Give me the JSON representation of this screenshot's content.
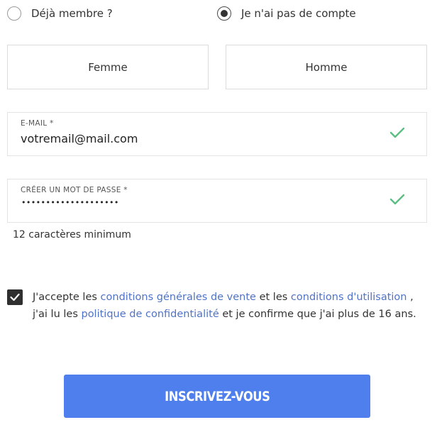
{
  "account_choice": {
    "options": [
      {
        "label": "Déjà membre ?",
        "selected": false
      },
      {
        "label": "Je n'ai pas de compte",
        "selected": true
      }
    ]
  },
  "gender": {
    "female_label": "Femme",
    "male_label": "Homme"
  },
  "email_field": {
    "label": "E-MAIL *",
    "value": "votremail@mail.com",
    "status_icon": "check-icon",
    "valid_color": "#5bbf84"
  },
  "password_field": {
    "label": "CRÉER UN MOT DE PASSE *",
    "masked_value": "••••••••••••••••••••",
    "status_icon": "check-icon",
    "hint": "12 caractères minimum"
  },
  "terms": {
    "checked": true,
    "text_1": "J'accepte les ",
    "link_cgv": "conditions générales de vente",
    "text_2": " et les ",
    "link_cgu": "conditions d'utilisation",
    "text_3": " , j'ai lu les ",
    "link_privacy": "politique de confidentialité",
    "text_4": " et je confirme que j'ai plus de 16 ans.",
    "link_color": "#4f73c6"
  },
  "submit": {
    "label": "INSCRIVEZ-VOUS",
    "color": "#4f7fed"
  }
}
